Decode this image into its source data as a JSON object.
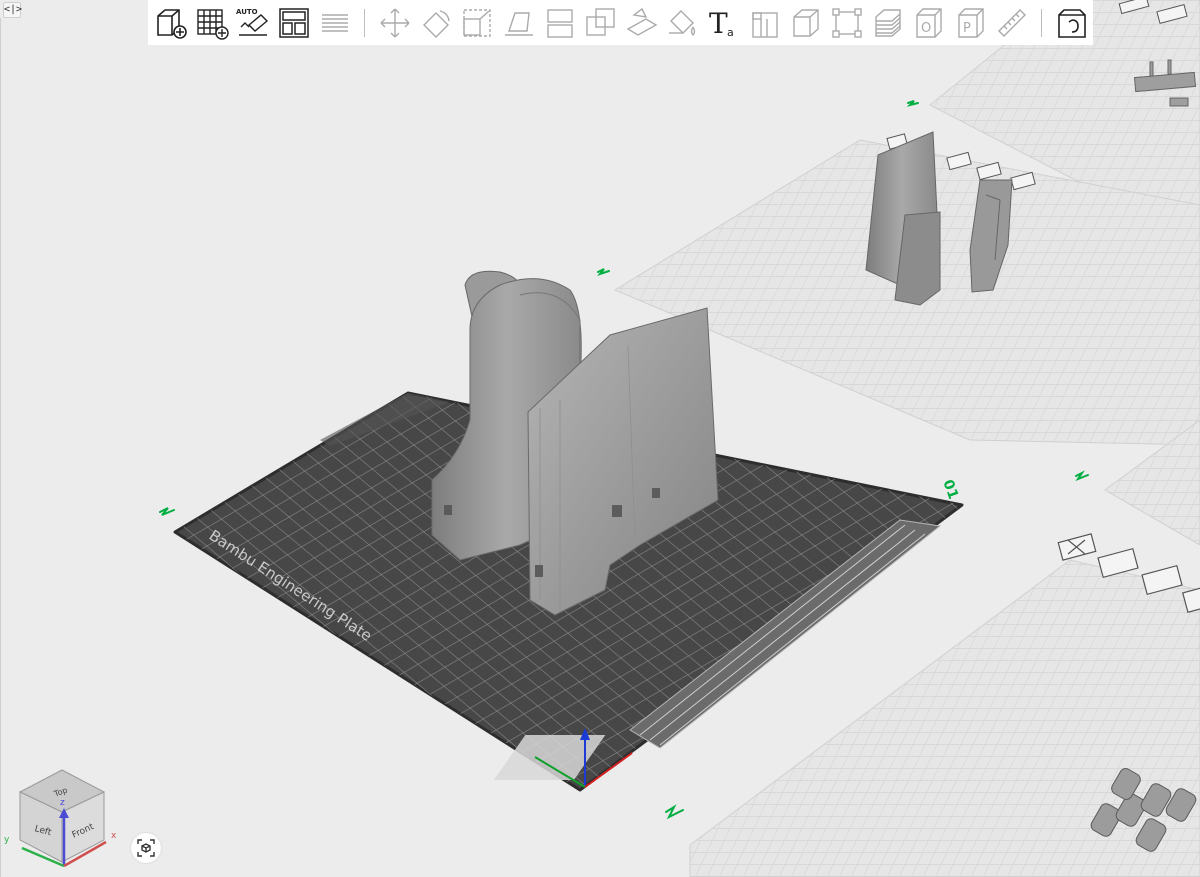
{
  "ui": {
    "collapse_label": "<|>",
    "colors": {
      "accent": "#00ae42",
      "toolbar_bg": "#ffffff",
      "canvas_bg": "#ececec",
      "plate": "#474747"
    }
  },
  "toolbar": {
    "tools": [
      {
        "name": "add-object",
        "icon": "cube-plus-icon"
      },
      {
        "name": "add-plate",
        "icon": "grid-plus-icon"
      },
      {
        "name": "auto-orient",
        "icon": "auto-orient-icon",
        "label": "AUTO"
      },
      {
        "name": "arrange",
        "icon": "arrange-icon"
      },
      {
        "name": "split-layers",
        "icon": "layers-icon"
      },
      {
        "name": "move",
        "icon": "move-icon"
      },
      {
        "name": "rotate",
        "icon": "rotate-icon"
      },
      {
        "name": "scale",
        "icon": "scale-icon"
      },
      {
        "name": "lay-on-face",
        "icon": "lay-on-face-icon"
      },
      {
        "name": "cut",
        "icon": "cut-icon"
      },
      {
        "name": "boolean",
        "icon": "boolean-icon"
      },
      {
        "name": "support-paint",
        "icon": "support-paint-icon"
      },
      {
        "name": "color-paint",
        "icon": "color-paint-icon"
      },
      {
        "name": "text",
        "icon": "text-icon",
        "label": "T",
        "sub_label": "a"
      },
      {
        "name": "seam",
        "icon": "seam-icon"
      },
      {
        "name": "assembly",
        "icon": "assembly-icon"
      },
      {
        "name": "measure-box",
        "icon": "measure-box-icon"
      },
      {
        "name": "layer-stack",
        "icon": "layer-stack-icon"
      },
      {
        "name": "shell",
        "icon": "shell-icon",
        "label": "O"
      },
      {
        "name": "plate-object",
        "icon": "plate-object-icon",
        "label": "P"
      },
      {
        "name": "ruler",
        "icon": "ruler-icon"
      },
      {
        "name": "assembly-view",
        "icon": "assembly-view-icon"
      }
    ]
  },
  "plate": {
    "label": "Bambu Engineering Plate",
    "number": "01"
  },
  "view_cube": {
    "top": "Top",
    "left": "Left",
    "front": "Front",
    "x": "x",
    "y": "y",
    "z": "z"
  }
}
